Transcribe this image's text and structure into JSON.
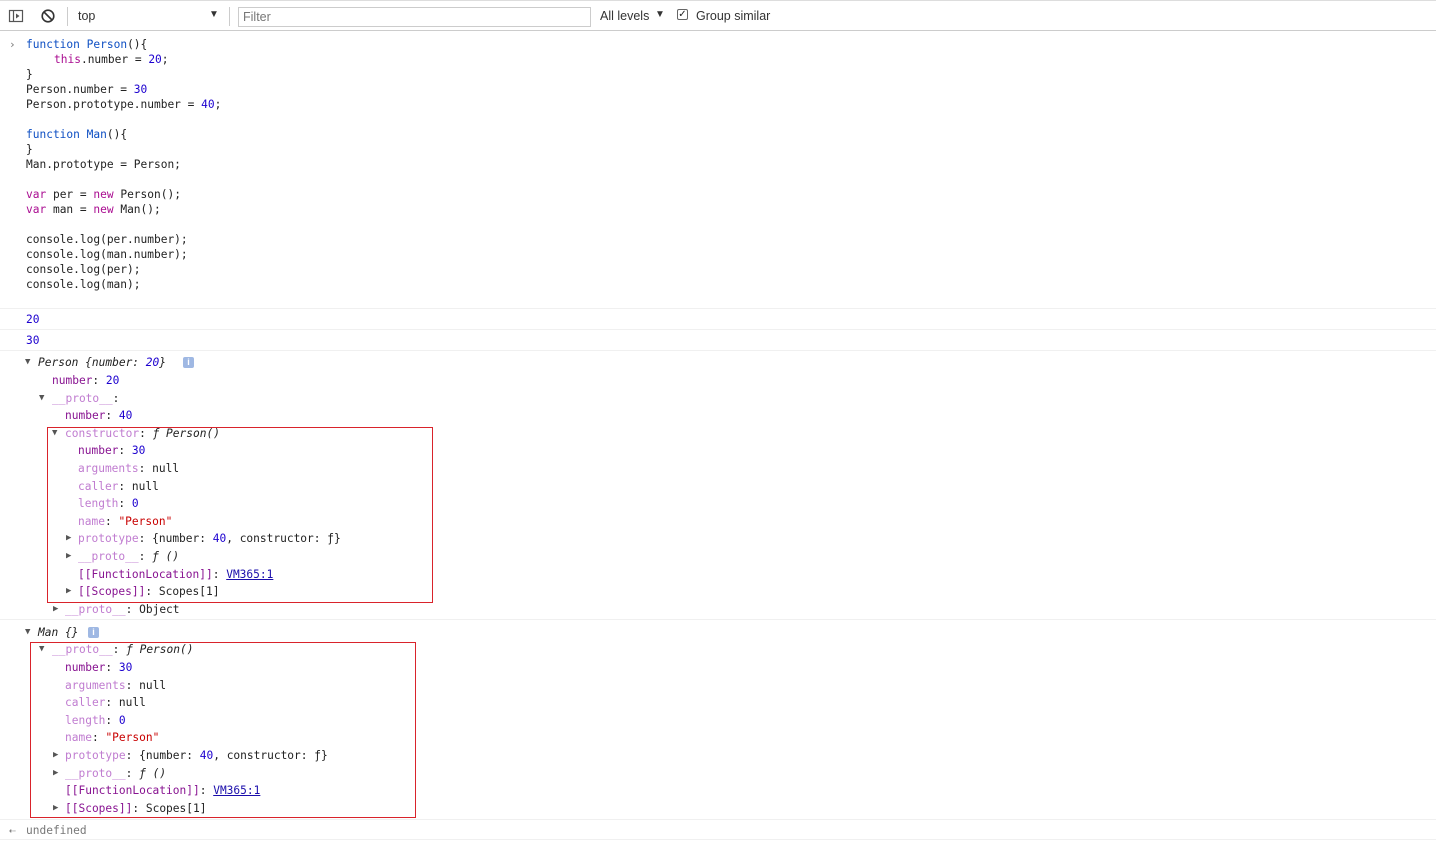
{
  "toolbar": {
    "context": "top",
    "filter_placeholder": "Filter",
    "levels": "All levels",
    "group_similar": "Group similar"
  },
  "input_code": {
    "l1_kw": "function",
    "l1_name": "Person",
    "l1_rest": "(){",
    "l2_this": "this",
    "l2_mid": ".number = ",
    "l2_num": "20",
    "l2_end": ";",
    "l3": "}",
    "l4_a": "Person.number = ",
    "l4_num": "30",
    "l5_a": "Person.prototype.number = ",
    "l5_num": "40",
    "l5_end": ";",
    "l6_kw": "function",
    "l6_name": "Man",
    "l6_rest": "(){",
    "l7": "}",
    "l8": "Man.prototype = Person;",
    "l9_kw": "var",
    "l9_a": " per = ",
    "l9_new": "new",
    "l9_b": " Person();",
    "l10_kw": "var",
    "l10_a": " man = ",
    "l10_new": "new",
    "l10_b": " Man();",
    "l11": "console.log(per.number);",
    "l12": "console.log(man.number);",
    "l13": "console.log(per);",
    "l14": "console.log(man);"
  },
  "outputs": {
    "out1": "20",
    "out2": "30",
    "per": {
      "header_name": "Person",
      "header_rest": " {number: ",
      "header_num": "20",
      "header_end": "}",
      "number_key": "number",
      "number_val": "20",
      "proto_key": "__proto__",
      "proto_number_key": "number",
      "proto_number_val": "40",
      "ctor_key": "constructor",
      "ctor_val": "ƒ Person()",
      "c_number_key": "number",
      "c_number_val": "30",
      "c_arguments_key": "arguments",
      "c_arguments_val": "null",
      "c_caller_key": "caller",
      "c_caller_val": "null",
      "c_length_key": "length",
      "c_length_val": "0",
      "c_name_key": "name",
      "c_name_val": "\"Person\"",
      "c_prototype_key": "prototype",
      "c_prototype_a": "{number: ",
      "c_prototype_num": "40",
      "c_prototype_b": ", constructor: ƒ}",
      "c_proto_key": "__proto__",
      "c_proto_val": "ƒ ()",
      "c_fl_key": "[[FunctionLocation]]",
      "c_fl_val": "VM365:1",
      "c_scopes_key": "[[Scopes]]",
      "c_scopes_val": "Scopes[1]",
      "object_proto_key": "__proto__",
      "object_proto_val": "Object"
    },
    "man": {
      "header": "Man {}",
      "proto_key": "__proto__",
      "proto_val": "ƒ Person()",
      "number_key": "number",
      "number_val": "30",
      "arguments_key": "arguments",
      "arguments_val": "null",
      "caller_key": "caller",
      "caller_val": "null",
      "length_key": "length",
      "length_val": "0",
      "name_key": "name",
      "name_val": "\"Person\"",
      "prototype_key": "prototype",
      "prototype_a": "{number: ",
      "prototype_num": "40",
      "prototype_b": ", constructor: ƒ}",
      "proto2_key": "__proto__",
      "proto2_val": "ƒ ()",
      "fl_key": "[[FunctionLocation]]",
      "fl_val": "VM365:1",
      "scopes_key": "[[Scopes]]",
      "scopes_val": "Scopes[1]"
    },
    "result": "undefined"
  },
  "icons": {
    "sidebar": "sidebar-toggle-icon",
    "clear": "clear-console-icon",
    "info": "i"
  }
}
